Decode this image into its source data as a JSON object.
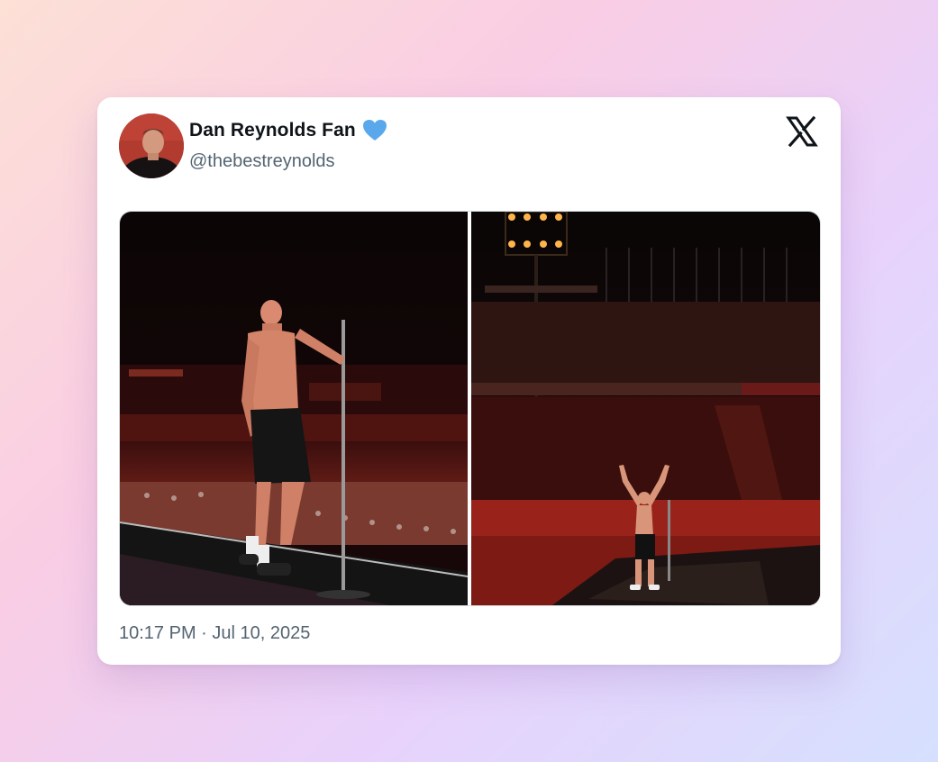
{
  "tweet": {
    "author_name": "Dan Reynolds Fan",
    "author_handle": "@thebestreynolds",
    "timestamp": "10:17 PM · Jul 10, 2025"
  },
  "icons": {
    "verified": "blue-heart-icon",
    "platform": "x-logo-icon"
  },
  "colors": {
    "heart": "#5aa8ec",
    "name": "#0f1419",
    "secondary_text": "#536471"
  }
}
